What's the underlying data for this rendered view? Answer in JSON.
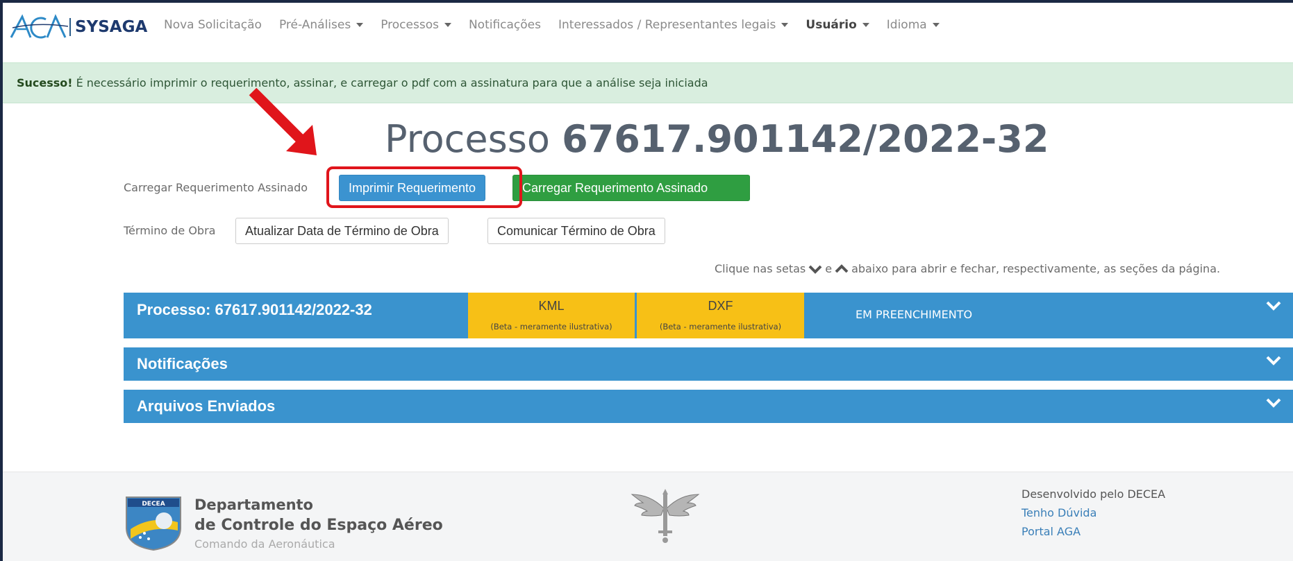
{
  "navbar": {
    "brand_logo": "AGA",
    "brand_name": "SYSAGA",
    "links": [
      {
        "label": "Nova Solicitação",
        "dropdown": false,
        "bold": false
      },
      {
        "label": "Pré-Análises",
        "dropdown": true,
        "bold": false
      },
      {
        "label": "Processos",
        "dropdown": true,
        "bold": false
      },
      {
        "label": "Notificações",
        "dropdown": false,
        "bold": false
      },
      {
        "label": "Interessados / Representantes legais",
        "dropdown": true,
        "bold": false
      },
      {
        "label": "Usuário",
        "dropdown": true,
        "bold": true
      },
      {
        "label": "Idioma",
        "dropdown": true,
        "bold": false
      }
    ]
  },
  "alert": {
    "strong": "Sucesso!",
    "message": "É necessário imprimir o requerimento, assinar, e carregar o pdf com a assinatura para que a análise seja iniciada",
    "color": "#d9eedf"
  },
  "title": {
    "prefix": "Processo",
    "number": "67617.901142/2022-32"
  },
  "signed_row": {
    "label": "Carregar Requerimento Assinado",
    "print_button": "Imprimir Requerimento",
    "upload_button": "Carregar Requerimento Assinado"
  },
  "end_row": {
    "label": "Término de Obra",
    "update_button": "Atualizar Data de Término de Obra",
    "communicate_button": "Comunicar Término de Obra"
  },
  "hint": {
    "before": "Clique nas setas",
    "middle": "e",
    "after": "abaixo para abrir e fechar, respectivamente, as seções da página.",
    "down_icon": "chevron-down-icon",
    "up_icon": "chevron-up-icon"
  },
  "panels": {
    "process": {
      "title": "Processo: 67617.901142/2022-32",
      "kml": {
        "label": "KML",
        "sub": "(Beta - meramente ilustrativa)"
      },
      "dxf": {
        "label": "DXF",
        "sub": "(Beta - meramente ilustrativa)"
      },
      "status": "EM PREENCHIMENTO"
    },
    "notifications": {
      "title": "Notificações"
    },
    "files": {
      "title": "Arquivos Enviados"
    },
    "panel_color": "#3a93ce",
    "cell_color": "#f7c016"
  },
  "footer": {
    "logo_text": "DECEA",
    "dept_line1": "Departamento",
    "dept_line2": "de Controle do Espaço Aéreo",
    "dept_line3": "Comando da Aeronáutica",
    "dev_by": "Desenvolvido pelo DECEA",
    "help_link": "Tenho Dúvida",
    "portal_link": "Portal AGA"
  },
  "colors": {
    "primary_button": "#3b93d0",
    "success_button": "#2f9e41",
    "highlight": "#e0151b"
  }
}
